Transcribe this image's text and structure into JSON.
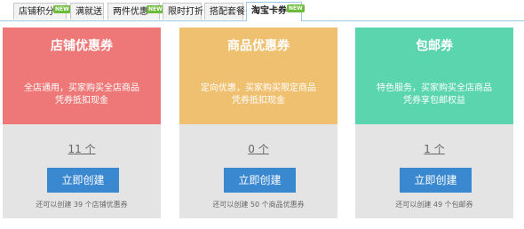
{
  "tabs": [
    {
      "label": "店铺积分",
      "badge": "NEW"
    },
    {
      "label": "满就送",
      "badge": ""
    },
    {
      "label": "两件优惠",
      "badge": "NEW"
    },
    {
      "label": "限时打折",
      "badge": ""
    },
    {
      "label": "搭配套餐",
      "badge": ""
    },
    {
      "label": "淘宝卡券",
      "badge": "NEW"
    }
  ],
  "active_tab": "淘宝卡券",
  "colors": {
    "card_store": "#ee7777",
    "card_product": "#f0c071",
    "card_shipping": "#5bd5ad",
    "button": "#3a88d0",
    "badge": "#6dbb3a"
  },
  "cards": [
    {
      "title": "店铺优惠券",
      "desc_line1": "全店通用，买家购买全店商品",
      "desc_line2": "凭券抵扣现金",
      "count": "11 个",
      "button": "立即创建",
      "remain": "还可以创建 39 个店铺优惠券"
    },
    {
      "title": "商品优惠券",
      "desc_line1": "定向优惠，买家购买限定商品",
      "desc_line2": "凭券抵扣现金",
      "count": "0 个",
      "button": "立即创建",
      "remain": "还可以创建 50 个商品优惠券"
    },
    {
      "title": "包邮券",
      "desc_line1": "特色服务，买家购买全店商品",
      "desc_line2": "凭券享包邮权益",
      "count": "1 个",
      "button": "立即创建",
      "remain": "还可以创建 49 个包邮券"
    }
  ]
}
